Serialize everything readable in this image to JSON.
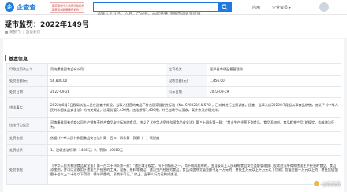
{
  "header": {
    "logo_text": "企查查",
    "logo_mark": "企",
    "badge_line1": "国家授权个人信用评估机构",
    "badge_line2": "国家权威数据服务机构",
    "search_placeholder": "请输入企业名、人名、产品名、品牌名等 搜索查询更多结果",
    "nav": [
      "应用",
      "企业会员"
    ]
  },
  "title": {
    "text": "疑市监罚：2022年149号",
    "meta": [
      "某部门",
      "监督处罚"
    ]
  },
  "section": {
    "title": "基本信息"
  },
  "table": {
    "rows": [
      {
        "l1": "行政处罚决定书",
        "v1": "河南康维固有会商公司",
        "l2": "处罚机关",
        "v2": "延津县市场监督管理局"
      },
      {
        "l1": "处罚金额(元)",
        "v1": "56,800.00",
        "l2": "没收金额(元)",
        "v2": "1,456.00"
      },
      {
        "l1": "处罚日期",
        "v1": "2022-09-28",
        "l2": "公示日期",
        "v2": "2022-09-29"
      },
      {
        "l1": "违法事实",
        "v1": "2022年8月1日我局执法人员在巡查中发现，当事人经营的商品不符合国家强制性标准（No. SP0320/10.570），已对其进行立案调查。经查，当事人自2022年7月起从事食品销售，违反了《中华人民共和国食品安全法》的有关规定，涉案货值1,456元，违法所得1,456元，并已当场予以没收，案件依法办理完毕。"
      },
      {
        "l1": "违法行为类型",
        "v1": "河南康维固有会商公司生产销售不符合食品安全标准的食品，违反了《中华人民共和国食品安全法》第三十四条第一款：“禁止生产经营下列食品、食品添加剂、食品相关产品”的规定，构成违法行为。"
      },
      {
        "l1": "处罚依据",
        "v1": "依据《中华人民共和国食品安全法》第一百二十四条第一款第（一）项规定"
      },
      {
        "l1": "处罚结果",
        "v1": "1、没收违法所得：1456元；2、罚款：50000元"
      },
      {
        "l1": "处罚依据",
        "v1": "《中华人民共和国食品安全法》第一百二十四条第一款：“违反本法规定，有下列情形之一，尚不构成犯罪的，由县级以上人民政府食品安全监督管理部门没收违法所得和违法生产经营的食品、食品添加剂，并可以没收用于违法生产经营的工具、设备、原料等物品；违法生产经营的食品、食品添加剂货值金额不足一万元的，并处五万元以上十万元以下罚款；货值金额一万元以上的，并处货值金额十倍以上二十倍以下罚款；情节严重的，吊销许可证。” 综上，当事人行为已构成违法。"
      }
    ]
  },
  "watermark": "@企查查"
}
